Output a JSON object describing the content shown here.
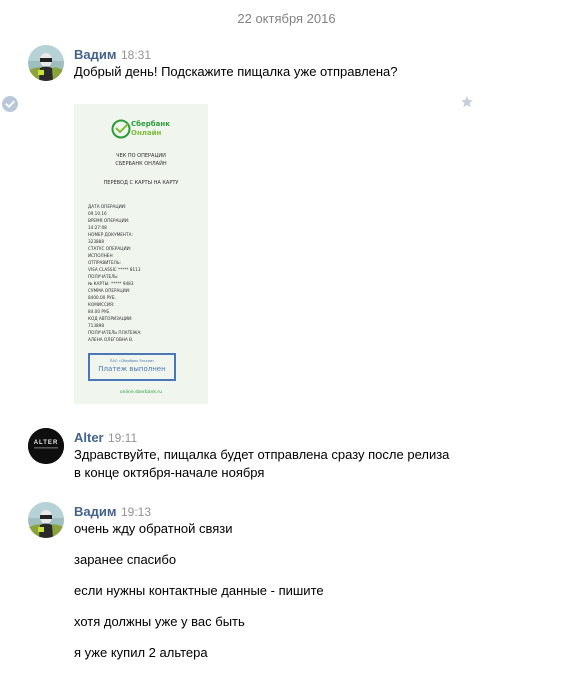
{
  "date_separator": "22 октября 2016",
  "messages": [
    {
      "author": "Вадим",
      "time": "18:31",
      "text": "Добрый день! Подскажите пищалка уже отправлена?"
    },
    {
      "author": "Alter",
      "time": "19:11",
      "lines": [
        "Здравствуйте, пищалка будет отправлена сразу после релиза",
        "в конце октября-начале ноября"
      ],
      "avatar_text": "ALTER"
    },
    {
      "author": "Вадим",
      "time": "19:13",
      "lines": [
        "очень жду обратной связи",
        "заранее спасибо",
        "если нужны контактные данные - пишите",
        "хотя должны уже у вас быть",
        "я уже купил 2 альтера"
      ]
    }
  ],
  "receipt": {
    "brand_line1": "Сбербанк",
    "brand_line2": "Онлайн",
    "title_line1": "ЧЕК ПО ОПЕРАЦИИ",
    "title_line2": "СБЕРБАНК ОНЛАЙН",
    "operation": "ПЕРЕВОД С КАРТЫ НА КАРТУ",
    "fields": [
      "ДАТА ОПЕРАЦИИ:",
      "09.10.16",
      "ВРЕМЯ ОПЕРАЦИИ:",
      "14:27:08",
      "НОМЕР ДОКУМЕНТА:",
      "323888",
      "СТАТУС ОПЕРАЦИИ:",
      "ИСПОЛНЕН",
      "ОТПРАВИТЕЛЬ:",
      "VISA CLASSIC ***** 8113",
      "ПОЛУЧАТЕЛЬ:",
      "№ КАРТЫ: ***** 9483",
      "СУММА ОПЕРАЦИИ:",
      "8400.00 РУБ.",
      "КОМИССИЯ:",
      "84.00 РУБ.",
      "КОД АВТОРИЗАЦИИ:",
      "713898",
      "ПОЛУЧАТЕЛЬ ПЛАТЕЖА:",
      "АЛЕНА ОЛЕГОВНА В."
    ],
    "stamp_small": "ПАО «Сбербанк России»",
    "stamp_main": "Платеж выполнен",
    "site": "online.sberbank.ru"
  },
  "colors": {
    "author": "#42648b",
    "time": "#939393",
    "date": "#828282",
    "sber_green": "#2a9d3a",
    "stamp_blue": "#4a76b6"
  },
  "icons": {
    "read_check": "check-circle-icon",
    "favorite": "star-icon"
  }
}
